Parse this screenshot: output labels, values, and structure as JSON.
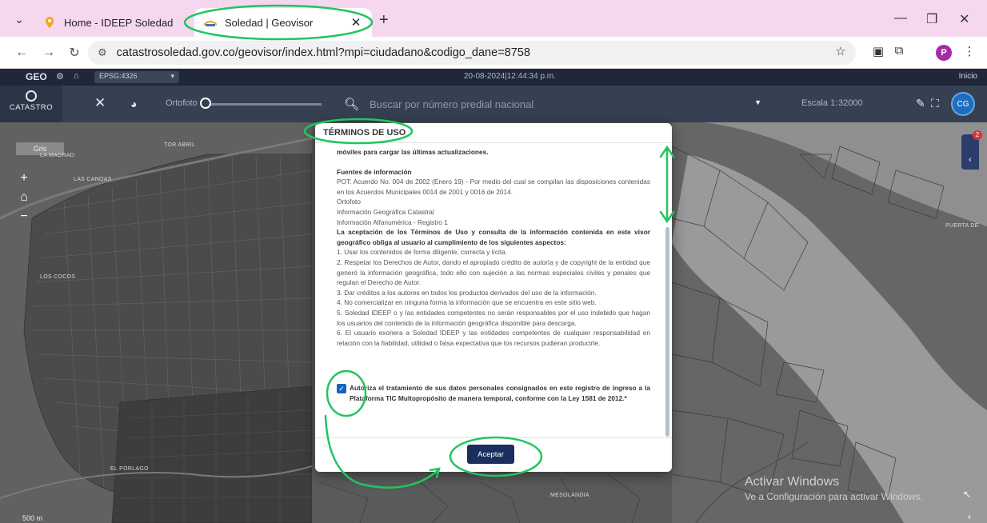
{
  "browser": {
    "tabs": [
      {
        "label": "Home - IDEEP Soledad",
        "favicon": "location-pin-icon",
        "active": false
      },
      {
        "label": "Soledad | Geovisor",
        "favicon": "site-logo-icon",
        "active": true
      }
    ],
    "url": "catastrosoledad.gov.co/geovisor/index.html?mpi=ciudadano&codigo_dane=8758",
    "profile_initial": "P",
    "profile_color": "#a72ba8"
  },
  "app": {
    "logo_text": "GEO",
    "epsg": "EPSG:4326",
    "datetime": "20-08-2024|12:44:34 p.m.",
    "inicio": "Inicio",
    "brand": "CATASTRO",
    "ortofoto_label": "Ortofoto",
    "search_placeholder": "Buscar por número predial nacional",
    "escala_label": "Escala 1:",
    "escala_value": "32000",
    "user_initials": "CG"
  },
  "map": {
    "gris_label": "Gris",
    "scale_label": "500 m",
    "notification_count": "2",
    "labels": [
      "LA MADRAD",
      "TOR ABRIL",
      "LAS CANOAS",
      "LOS COCOS",
      "EL PORLAGO",
      "MESOLANDIA",
      "PUERTA DE"
    ],
    "watermark_title": "Activar Windows",
    "watermark_sub": "Ve a Configuración para activar Windows."
  },
  "modal": {
    "title": "TÉRMINOS DE USO",
    "intro": "móviles para cargar las últimas actualizaciones.",
    "sources_title": "Fuentes de información",
    "pot": "POT: Acuerdo No. 004 de 2002 (Enero 19) - Por medio del cual se compilan las disposiciones contenidas en los Acuerdos Municipales 0014 de 2001 y 0016 de 2014.",
    "sources": [
      "Ortofoto",
      "Información Geográfica Catastral",
      "Información Alfanumérica - Registro 1"
    ],
    "acceptance": "La aceptación de los Términos de Uso y consulta de la información contenida en este visor geográfico obliga al usuario al cumplimiento de los siguientes aspectos:",
    "rules": [
      "1. Usar los contenidos de forma diligente, correcta y lícita.",
      "2. Respetar los Derechos de Autor, dando el apropiado crédito de autoría y de copyright de la entidad que generó la información geográfica, todo ello con sujeción a las normas especiales civiles y penales que regulan el Derecho de Autor.",
      "3. Dar créditos a los autores en todos los productos derivados del uso de la información.",
      "4. No comercializar en ninguna forma la información que se encuentra en este sitio web.",
      "5. Soledad IDEEP o y las entidades competentes no serán responsables por el uso indebido que hagan los usuarios del contenido de la información geográfica disponible para descarga.",
      "6. El usuario exonera a Soledad IDEEP y las entidades competentes de cualquier responsabilidad en relación con la fiabilidad, utilidad o falsa expectativa que los recursos pudieran producirle."
    ],
    "consent": "Autoriza el tratamiento de sus datos personales consignados en este registro de ingreso a la Plataforma TIC Multopropósito de manera temporal, conforme con la Ley 1581 de 2012.*",
    "consent_checked": true,
    "accept_label": "Aceptar"
  },
  "colors": {
    "annotation": "#22c55e",
    "accept_button": "#1b2f5e",
    "app_bar": "#354152",
    "tab_strip": "#f5d7ef"
  }
}
